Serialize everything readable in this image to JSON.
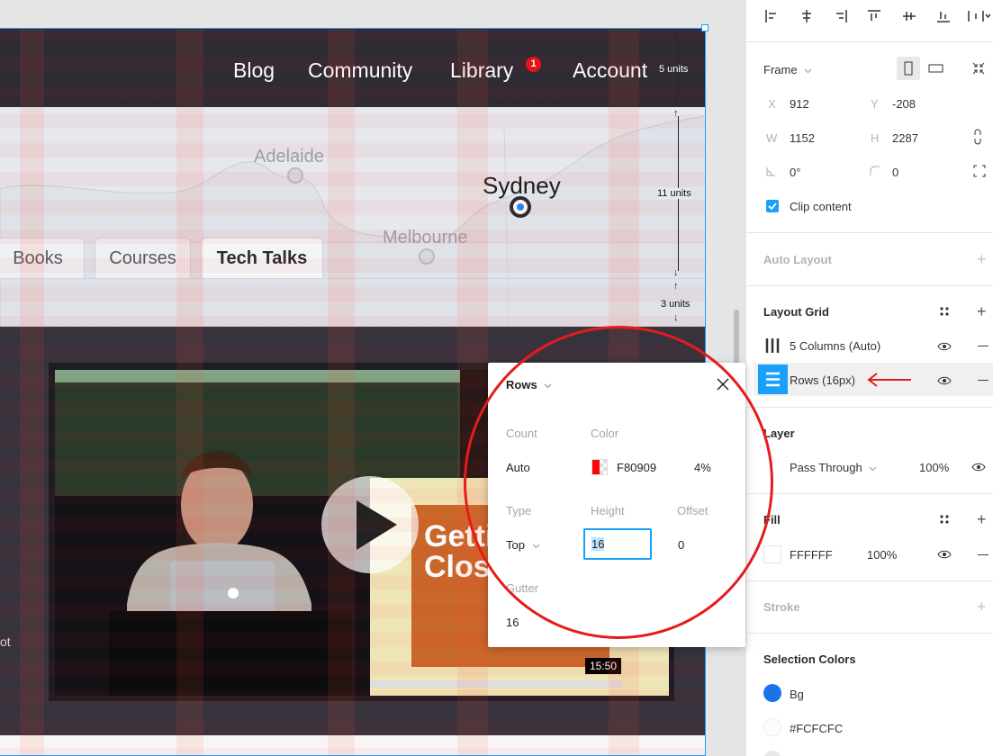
{
  "canvas": {
    "nav": {
      "links": [
        "Blog",
        "Community",
        "Library",
        "Account"
      ],
      "library_badge": "1"
    },
    "map": {
      "cities": [
        "Adelaide",
        "Sydney",
        "Melbourne"
      ]
    },
    "tabs": [
      "Books",
      "Courses",
      "Tech Talks"
    ],
    "video": {
      "slide_text_line1": "Getti",
      "slide_text_line2": "Closu",
      "duration": "15:50",
      "caption_truncated": "ot"
    },
    "measurements": {
      "top": "5 units",
      "middle": "11 units",
      "bottom": "3 units"
    }
  },
  "popover": {
    "title": "Rows",
    "count_label": "Count",
    "count_value": "Auto",
    "color_label": "Color",
    "color_hex": "F80909",
    "color_opacity": "4%",
    "type_label": "Type",
    "type_value": "Top",
    "height_label": "Height",
    "height_value": "16",
    "offset_label": "Offset",
    "offset_value": "0",
    "gutter_label": "Gutter",
    "gutter_value": "16",
    "swatch_color": "#F80909"
  },
  "panel": {
    "frame": {
      "label": "Frame",
      "x_label": "X",
      "x_value": "912",
      "y_label": "Y",
      "y_value": "-208",
      "w_label": "W",
      "w_value": "1152",
      "h_label": "H",
      "h_value": "2287",
      "rotation_value": "0°",
      "radius_value": "0",
      "clip_content_label": "Clip content",
      "clip_content_checked": true
    },
    "auto_layout": {
      "title": "Auto Layout"
    },
    "layout_grid": {
      "title": "Layout Grid",
      "items": [
        "5 Columns (Auto)",
        "Rows (16px)"
      ]
    },
    "layer": {
      "title": "Layer",
      "blend_mode": "Pass Through",
      "opacity": "100%"
    },
    "fill": {
      "title": "Fill",
      "hex": "FFFFFF",
      "opacity": "100%"
    },
    "stroke": {
      "title": "Stroke"
    },
    "selection_colors": {
      "title": "Selection Colors",
      "items": [
        {
          "label": "Bg",
          "color": "#1a73e8"
        },
        {
          "label": "#FCFCFC",
          "color": "#FCFCFC"
        }
      ]
    }
  },
  "colors": {
    "accent": "#18A0FB",
    "annotation_red": "#E51C1C",
    "nav_bg": "#2E2B34"
  }
}
